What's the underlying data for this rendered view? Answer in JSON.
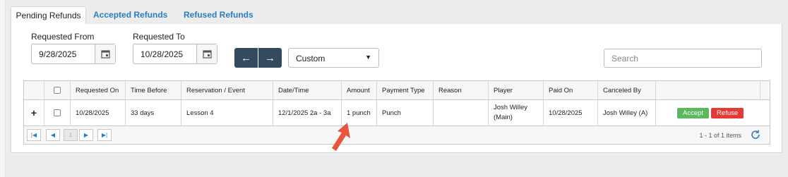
{
  "tabs": [
    {
      "label": "Pending Refunds",
      "active": true
    },
    {
      "label": "Accepted Refunds",
      "active": false
    },
    {
      "label": "Refused Refunds",
      "active": false
    }
  ],
  "filters": {
    "from_label": "Requested From",
    "from_value": "9/28/2025",
    "to_label": "Requested To",
    "to_value": "10/28/2025",
    "range_select": "Custom",
    "search_placeholder": "Search"
  },
  "table": {
    "columns": [
      "Requested On",
      "Time Before",
      "Reservation / Event",
      "Date/Time",
      "Amount",
      "Payment Type",
      "Reason",
      "Player",
      "Paid On",
      "Canceled By"
    ],
    "rows": [
      {
        "requested_on": "10/28/2025",
        "time_before": "33 days",
        "event": "Lesson 4",
        "date_time": "12/1/2025 2a - 3a",
        "amount": "1 punch",
        "payment_type": "Punch",
        "reason": "",
        "player_line1": "Josh Willey",
        "player_line2": "(Main)",
        "paid_on": "10/28/2025",
        "canceled_by": "Josh Willey (A)",
        "accept_label": "Accept",
        "refuse_label": "Refuse"
      }
    ]
  },
  "pager": {
    "page": "1",
    "info": "1 - 1 of 1 items"
  },
  "colors": {
    "accent": "#2c7cc4",
    "nav_button": "#34495e",
    "accept": "#5cb85c",
    "refuse": "#e53935",
    "pointer_arrow": "#e8553a"
  }
}
